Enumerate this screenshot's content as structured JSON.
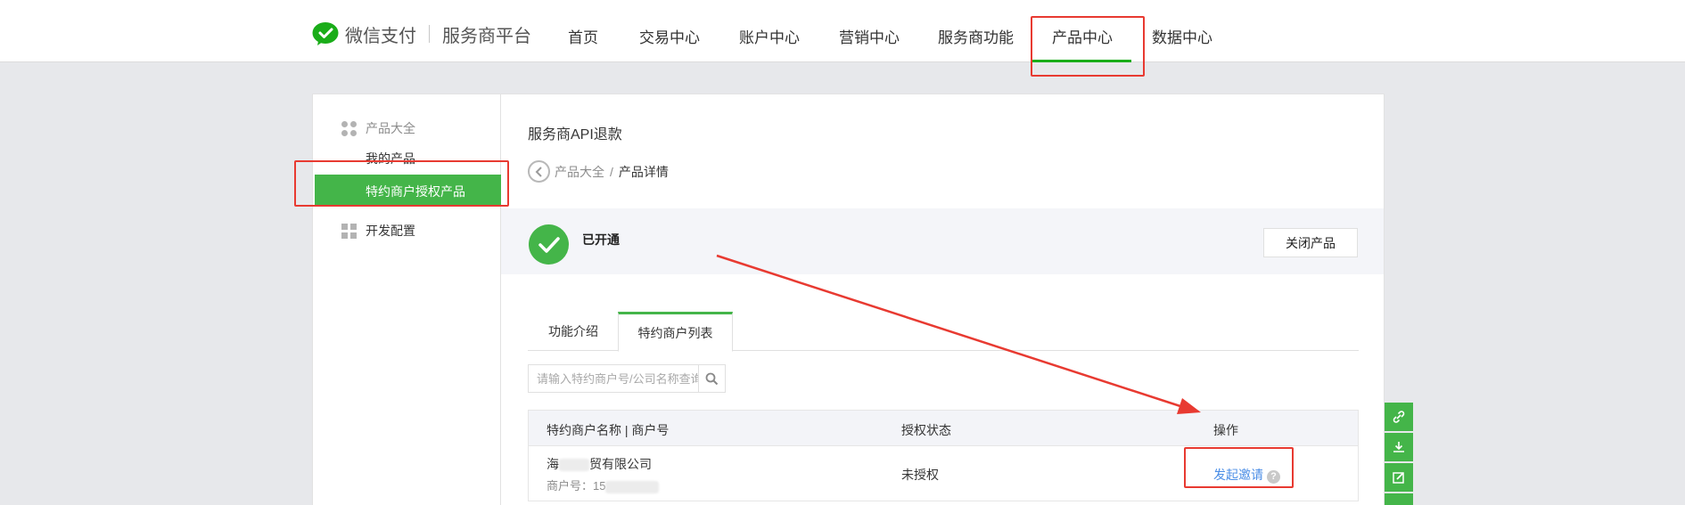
{
  "header": {
    "brand_name": "微信支付",
    "platform_name": "服务商平台",
    "nav": [
      "首页",
      "交易中心",
      "账户中心",
      "营销中心",
      "服务商功能",
      "产品中心",
      "数据中心"
    ],
    "active_nav": "产品中心"
  },
  "sidebar": {
    "group_products": "产品大全",
    "item_my_products": "我的产品",
    "item_active": "特约商户授权产品",
    "group_dev": "开发配置"
  },
  "content": {
    "title": "服务商API退款",
    "breadcrumb": {
      "parent": "产品大全",
      "separator": "/",
      "current": "产品详情"
    },
    "status": "已开通",
    "close_button": "关闭产品",
    "tabs": [
      "功能介绍",
      "特约商户列表"
    ],
    "active_tab": "特约商户列表",
    "search_placeholder": "请输入特约商户号/公司名称查询",
    "table": {
      "headers": [
        "特约商户名称 | 商户号",
        "授权状态",
        "操作"
      ],
      "rows": [
        {
          "name_prefix": "海",
          "name_suffix": "贸有限公司",
          "merchant_id_label": "商户号：15",
          "status": "未授权",
          "action": "发起邀请"
        }
      ]
    }
  },
  "colors": {
    "accent_green": "#44b549",
    "link_blue": "#4b8ee6",
    "annotation_red": "#e83a31"
  }
}
